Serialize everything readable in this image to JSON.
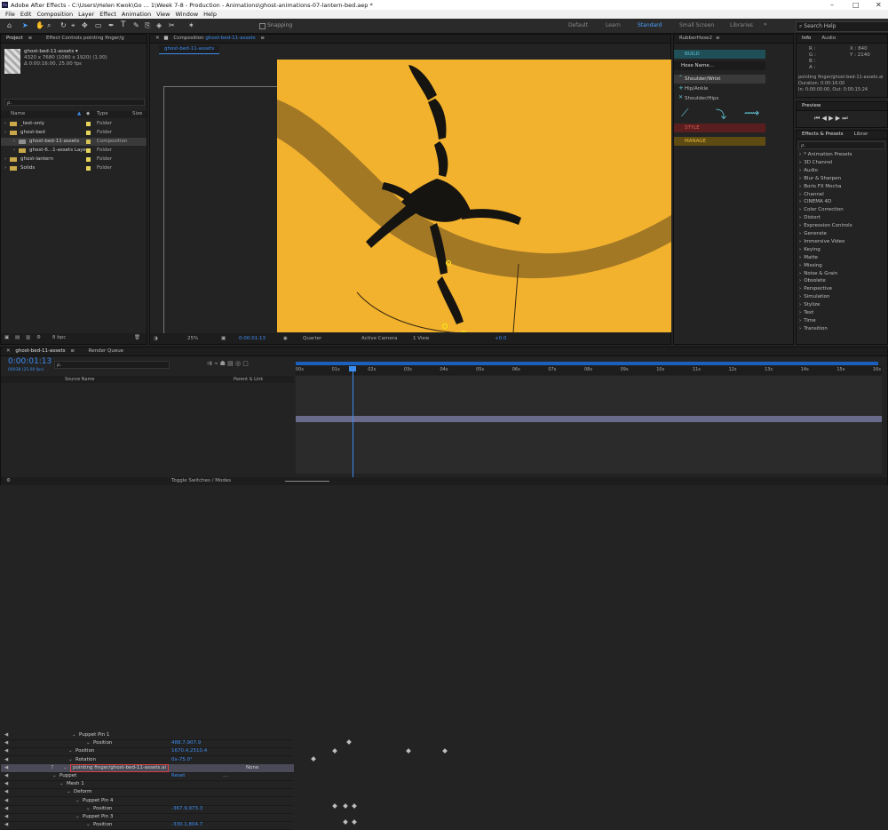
{
  "window": {
    "title": "Adobe After Effects - C:\\Users\\Helen Kwok\\Go ... 1\\Week 7-8 - Production - Animations\\ghost-animations-07-lantern-bed.aep *"
  },
  "menu": [
    "File",
    "Edit",
    "Composition",
    "Layer",
    "Effect",
    "Animation",
    "View",
    "Window",
    "Help"
  ],
  "toolbar": {
    "snapping": "Snapping",
    "workspaces": [
      "Default",
      "Learn",
      "Standard",
      "Small Screen",
      "Libraries"
    ],
    "active_workspace": "Standard",
    "search_placeholder": "Search Help"
  },
  "project": {
    "tab": "Project",
    "effect_controls_tab": "Effect Controls pointing finger/g",
    "item_name": "ghost-bed-11-assets ▾",
    "item_dims": "4320 x 7680  (1080 x 1920) (1.00)",
    "item_dur": "Δ 0:00:16:00, 25.00 fps",
    "search_placeholder": "ρ.",
    "cols": {
      "name": "Name",
      "type": "Type",
      "size": "Size"
    },
    "items": [
      {
        "name": "_test-only",
        "type": "Folder"
      },
      {
        "name": "ghost-bed",
        "type": "Folder"
      },
      {
        "name": "ghost-bed-11-assets",
        "type": "Composition"
      },
      {
        "name": "ghost-6...1-assets Layers",
        "type": "Folder"
      },
      {
        "name": "ghost-lantern",
        "type": "Folder"
      },
      {
        "name": "Solids",
        "type": "Folder"
      }
    ],
    "bpc": "8 bpc"
  },
  "composition": {
    "tab": "Composition",
    "tab_name": "ghost-bed-11-assets",
    "sub_tab": "ghost-bed-11-assets",
    "zoom": "25%",
    "time": "0:00:01:13",
    "resolution": "Quarter",
    "camera": "Active Camera",
    "view": "1 View",
    "exposure": "+0.0"
  },
  "rubberhose": {
    "title": "RubberHose2",
    "build": "BUILD",
    "hose_name": "Hose Name...",
    "items": [
      "Shoulder/Wrist",
      "Hip/Ankle",
      "Shoulder/Hips"
    ],
    "style": "STYLE",
    "manage": "MANAGE"
  },
  "info": {
    "tab": "Info",
    "audio_tab": "Audio",
    "r": "R :",
    "g": "G :",
    "b": "B :",
    "a": "A :",
    "x": "X : 840",
    "y": "Y : 2140",
    "layer": "pointing finger/ghost-bed-11-assets.ai",
    "duration": "Duration: 0:00:16:00",
    "inout": "In: 0:00:00:00, Out: 0:00:15:24"
  },
  "preview": {
    "tab": "Preview"
  },
  "effects": {
    "tab": "Effects & Presets",
    "tab2": "Librar",
    "search_placeholder": "ρ.",
    "items": [
      "* Animation Presets",
      "3D Channel",
      "Audio",
      "Blur & Sharpen",
      "Boris FX Mocha",
      "Channel",
      "CINEMA 4D",
      "Color Correction",
      "Distort",
      "Expression Controls",
      "Generate",
      "Immersive Video",
      "Keying",
      "Matte",
      "Missing",
      "Noise & Grain",
      "Obsolete",
      "Perspective",
      "Simulation",
      "Stylize",
      "Text",
      "Time",
      "Transition"
    ]
  },
  "timeline": {
    "tab": "ghost-bed-11-assets",
    "render_queue": "Render Queue",
    "time": "0:00:01:13",
    "frames": "00038 (25.00 fps)",
    "search_placeholder": "ρ.",
    "col_source": "Source Name",
    "col_parent": "Parent & Link",
    "ruler": [
      "00s",
      "01s",
      "02s",
      "03s",
      "04s",
      "05s",
      "06s",
      "07s",
      "08s",
      "09s",
      "10s",
      "11s",
      "12s",
      "13s",
      "14s",
      "15s",
      "16s"
    ],
    "rows": [
      {
        "label": "Puppet Pin 1",
        "value": ""
      },
      {
        "label": "Position",
        "value": "488.7,907.9"
      },
      {
        "label": "Position",
        "value": "1670.4,2510.4"
      },
      {
        "label": "Rotation",
        "value": "0x-75.0°"
      },
      {
        "label": "pointing finger/ghost-bed-11-assets.ai",
        "value": "None",
        "layer_num": "7"
      },
      {
        "label": "Puppet",
        "value": "Reset",
        "extra": "..."
      },
      {
        "label": "Mesh 1",
        "value": ""
      },
      {
        "label": "Deform",
        "value": ""
      },
      {
        "label": "Puppet Pin 4",
        "value": ""
      },
      {
        "label": "Position",
        "value": "-367.9,973.3"
      },
      {
        "label": "Puppet Pin 3",
        "value": ""
      },
      {
        "label": "Position",
        "value": "-330.1,804.7"
      }
    ],
    "toggle": "Toggle Switches / Modes"
  },
  "colors": {
    "canvas": "#f2b22e",
    "accent_blue": "#3d8cf0",
    "rh_teal": "#2a7f8a",
    "rh_red": "#8e2a2a",
    "rh_gold": "#9a7a1c"
  }
}
